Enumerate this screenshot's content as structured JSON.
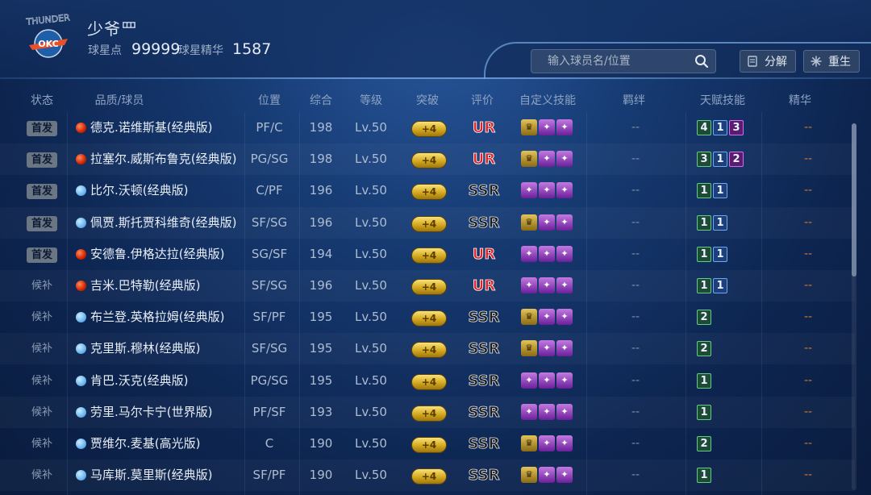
{
  "header": {
    "player_name": "少爷罒",
    "points_label": "球星点",
    "points_value": "99999",
    "essence_label": "球星精华",
    "essence_value": "1587",
    "search_placeholder": "输入球员名/位置",
    "decompose_label": "分解",
    "rebirth_label": "重生",
    "logo_text": "THUNDER OKC"
  },
  "columns": [
    "状态",
    "品质/球员",
    "位置",
    "综合",
    "等级",
    "突破",
    "评价",
    "自定义技能",
    "羁绊",
    "天赋技能",
    "精华"
  ],
  "colors": {
    "ur": "#e0242a",
    "talent_green": "#5fcf85",
    "talent_blue": "#6fa7f0",
    "talent_purple": "#d36cf0"
  },
  "rows": [
    {
      "status": "首发",
      "starter": true,
      "quality": "red",
      "name": "德克.诺维斯基(经典版)",
      "position": "PF/C",
      "overall": "198",
      "level": "Lv.50",
      "break": "+4",
      "rating": "UR",
      "skills": [
        "crown",
        "pur",
        "pur"
      ],
      "bond": "--",
      "talents": [
        {
          "v": "4",
          "c": "g"
        },
        {
          "v": "1",
          "c": "b"
        },
        {
          "v": "3",
          "c": "p"
        }
      ],
      "essence": "--"
    },
    {
      "status": "首发",
      "starter": true,
      "quality": "red",
      "name": "拉塞尔.威斯布鲁克(经典版)",
      "position": "PG/SG",
      "overall": "198",
      "level": "Lv.50",
      "break": "+4",
      "rating": "UR",
      "skills": [
        "crown",
        "pur",
        "pur"
      ],
      "bond": "--",
      "talents": [
        {
          "v": "3",
          "c": "g"
        },
        {
          "v": "1",
          "c": "b"
        },
        {
          "v": "2",
          "c": "p"
        }
      ],
      "essence": "--"
    },
    {
      "status": "首发",
      "starter": true,
      "quality": "blue",
      "name": "比尔.沃顿(经典版)",
      "position": "C/PF",
      "overall": "196",
      "level": "Lv.50",
      "break": "+4",
      "rating": "SSR",
      "skills": [
        "pur",
        "pur",
        "pur"
      ],
      "bond": "--",
      "talents": [
        {
          "v": "1",
          "c": "g"
        },
        {
          "v": "1",
          "c": "b"
        }
      ],
      "essence": "--"
    },
    {
      "status": "首发",
      "starter": true,
      "quality": "blue",
      "name": "佩贾.斯托贾科维奇(经典版)",
      "position": "SF/SG",
      "overall": "196",
      "level": "Lv.50",
      "break": "+4",
      "rating": "SSR",
      "skills": [
        "crown",
        "pur",
        "pur"
      ],
      "bond": "--",
      "talents": [
        {
          "v": "1",
          "c": "g"
        },
        {
          "v": "1",
          "c": "b"
        }
      ],
      "essence": "--"
    },
    {
      "status": "首发",
      "starter": true,
      "quality": "red",
      "name": "安德鲁.伊格达拉(经典版)",
      "position": "SG/SF",
      "overall": "194",
      "level": "Lv.50",
      "break": "+4",
      "rating": "UR",
      "skills": [
        "pur",
        "pur",
        "pur"
      ],
      "bond": "--",
      "talents": [
        {
          "v": "1",
          "c": "g"
        },
        {
          "v": "1",
          "c": "b"
        }
      ],
      "essence": "--"
    },
    {
      "status": "候补",
      "starter": false,
      "quality": "red",
      "name": "吉米.巴特勒(经典版)",
      "position": "SF/SG",
      "overall": "196",
      "level": "Lv.50",
      "break": "+4",
      "rating": "UR",
      "skills": [
        "pur",
        "pur",
        "pur"
      ],
      "bond": "--",
      "talents": [
        {
          "v": "1",
          "c": "g"
        },
        {
          "v": "1",
          "c": "b"
        }
      ],
      "essence": "--"
    },
    {
      "status": "候补",
      "starter": false,
      "quality": "blue",
      "name": "布兰登.英格拉姆(经典版)",
      "position": "SF/PF",
      "overall": "195",
      "level": "Lv.50",
      "break": "+4",
      "rating": "SSR",
      "skills": [
        "crown",
        "pur",
        "pur"
      ],
      "bond": "--",
      "talents": [
        {
          "v": "2",
          "c": "g"
        }
      ],
      "essence": "--"
    },
    {
      "status": "候补",
      "starter": false,
      "quality": "blue",
      "name": "克里斯.穆林(经典版)",
      "position": "SF/SG",
      "overall": "195",
      "level": "Lv.50",
      "break": "+4",
      "rating": "SSR",
      "skills": [
        "crown",
        "pur",
        "pur"
      ],
      "bond": "--",
      "talents": [
        {
          "v": "2",
          "c": "g"
        }
      ],
      "essence": "--"
    },
    {
      "status": "候补",
      "starter": false,
      "quality": "blue",
      "name": "肯巴.沃克(经典版)",
      "position": "PG/SG",
      "overall": "195",
      "level": "Lv.50",
      "break": "+4",
      "rating": "SSR",
      "skills": [
        "pur",
        "pur",
        "pur"
      ],
      "bond": "--",
      "talents": [
        {
          "v": "1",
          "c": "g"
        }
      ],
      "essence": "--"
    },
    {
      "status": "候补",
      "starter": false,
      "quality": "blue",
      "name": "劳里.马尔卡宁(世界版)",
      "position": "PF/SF",
      "overall": "193",
      "level": "Lv.50",
      "break": "+4",
      "rating": "SSR",
      "skills": [
        "pur",
        "pur",
        "pur"
      ],
      "bond": "--",
      "talents": [
        {
          "v": "1",
          "c": "g"
        }
      ],
      "essence": "--"
    },
    {
      "status": "候补",
      "starter": false,
      "quality": "blue",
      "name": "贾维尔.麦基(高光版)",
      "position": "C",
      "overall": "190",
      "level": "Lv.50",
      "break": "+4",
      "rating": "SSR",
      "skills": [
        "crown",
        "pur",
        "pur"
      ],
      "bond": "--",
      "talents": [
        {
          "v": "2",
          "c": "g"
        }
      ],
      "essence": "--"
    },
    {
      "status": "候补",
      "starter": false,
      "quality": "blue",
      "name": "马库斯.莫里斯(经典版)",
      "position": "SF/PF",
      "overall": "190",
      "level": "Lv.50",
      "break": "+4",
      "rating": "SSR",
      "skills": [
        "crown",
        "pur",
        "pur"
      ],
      "bond": "--",
      "talents": [
        {
          "v": "1",
          "c": "g"
        }
      ],
      "essence": "--"
    }
  ]
}
